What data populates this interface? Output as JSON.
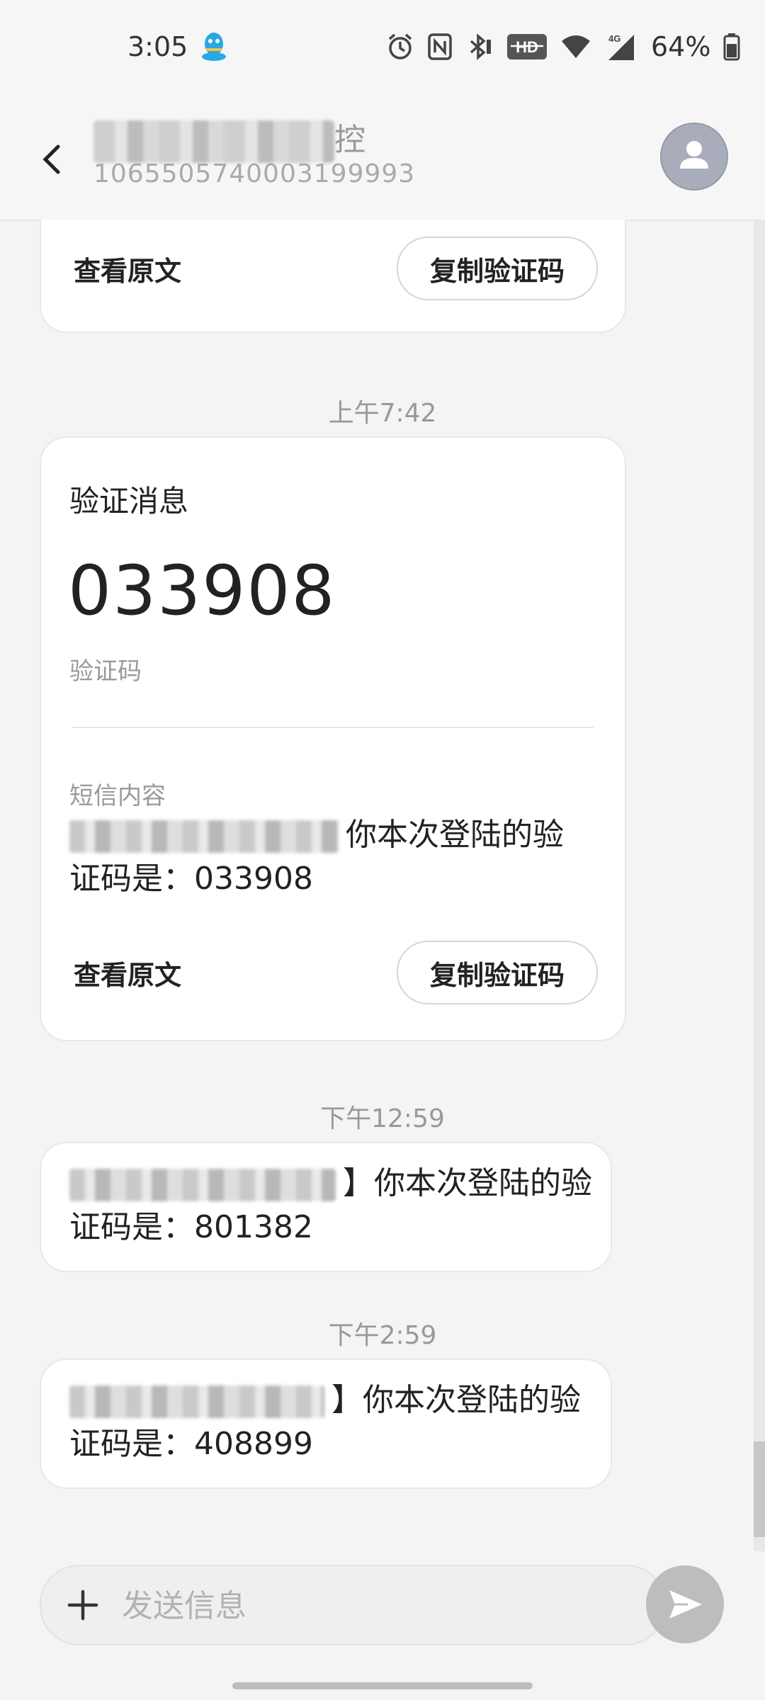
{
  "status_bar": {
    "time": "3:05",
    "battery_percent": "64%",
    "network_label": "4G",
    "icons": [
      "qq-icon",
      "alarm-icon",
      "nfc-icon",
      "bluetooth-icon",
      "hd-icon",
      "wifi-icon",
      "signal-icon",
      "battery-icon"
    ]
  },
  "header": {
    "contact_name_visible_char": "控",
    "contact_number": "1065505740003199993"
  },
  "messages": {
    "top_card": {
      "view_original": "查看原文",
      "copy_code": "复制验证码"
    },
    "card2": {
      "timestamp": "上午7:42",
      "title": "验证消息",
      "code": "033908",
      "code_label": "验证码",
      "sms_label": "短信内容",
      "body_line1": "你本次登陆的验",
      "body_line2": "证码是：033908",
      "view_original": "查看原文",
      "copy_code": "复制验证码"
    },
    "msg3": {
      "timestamp": "下午12:59",
      "body_line1": "】你本次登陆的验",
      "body_line2": "证码是：801382"
    },
    "msg4": {
      "timestamp": "下午2:59",
      "body_line1": "】你本次登陆的验",
      "body_line2": "证码是：408899"
    }
  },
  "compose": {
    "placeholder": "发送信息"
  }
}
